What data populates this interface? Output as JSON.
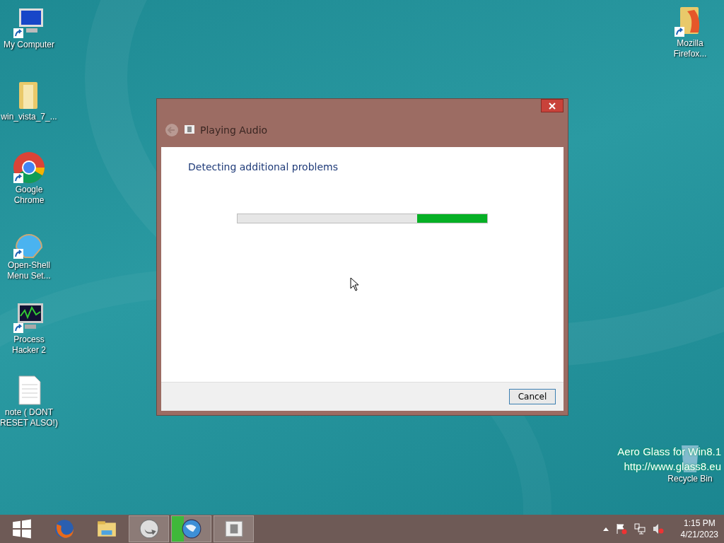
{
  "desktop_icons": [
    {
      "label": "My Computer",
      "kind": "computer",
      "shortcut": true
    },
    {
      "label": "win_vista_7_...",
      "kind": "folder",
      "shortcut": false
    },
    {
      "label": "Google Chrome",
      "kind": "chrome",
      "shortcut": true
    },
    {
      "label": "Open-Shell Menu Set...",
      "kind": "shell",
      "shortcut": true
    },
    {
      "label": "Process Hacker 2",
      "kind": "monitor",
      "shortcut": true
    },
    {
      "label": "note ( DONT RESET ALSO!)",
      "kind": "document",
      "shortcut": false
    }
  ],
  "right_icons": [
    {
      "label": "Mozilla Firefox...",
      "kind": "firefoxfolder",
      "shortcut": true
    },
    {
      "label": "Recycle Bin",
      "kind": "bin",
      "shortcut": false
    }
  ],
  "watermark_lines": [
    "Aero Glass for Win8.1",
    "http://www.glass8.eu"
  ],
  "dialog": {
    "title": "Playing Audio",
    "heading": "Detecting additional problems",
    "progress": {
      "level": 0.28
    },
    "buttons": [
      "Cancel"
    ]
  },
  "taskbar": {
    "items": [
      {
        "kind": "start",
        "running": false
      },
      {
        "kind": "firefox",
        "running": false
      },
      {
        "kind": "explorer",
        "running": false
      },
      {
        "kind": "arrow",
        "running": true
      },
      {
        "kind": "globe",
        "running": true,
        "level": 0.3
      },
      {
        "kind": "audio",
        "running": true
      }
    ],
    "tray": {
      "time": "1:15 PM",
      "date": "4/21/2023"
    }
  }
}
